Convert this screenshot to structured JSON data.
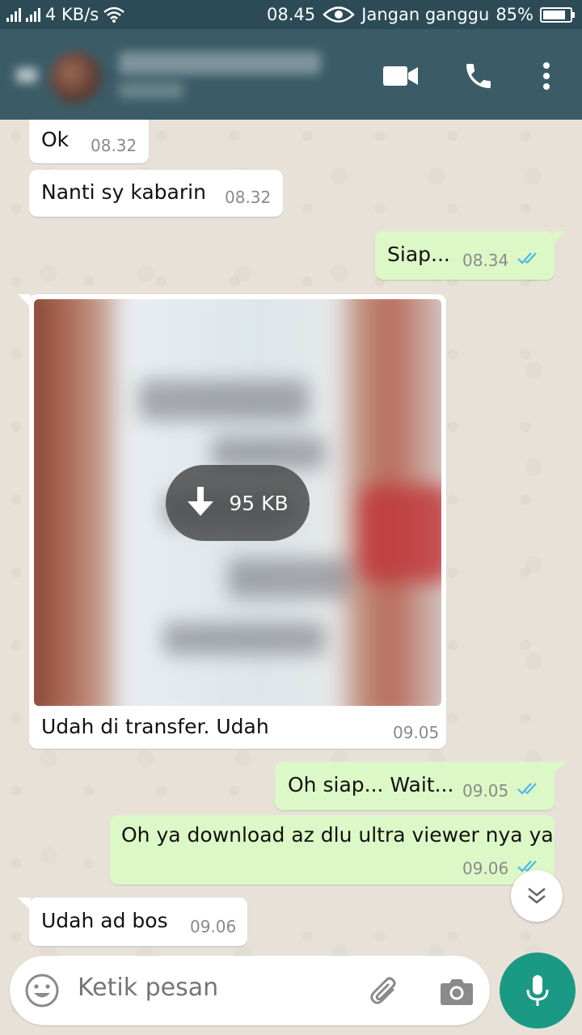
{
  "status_bar": {
    "network_speed": "4 KB/s",
    "time": "08.45",
    "dnd_label": "Jangan ganggu",
    "battery": "85%",
    "battery_level": 0.85
  },
  "header": {
    "contact_name": "",
    "contact_status": "",
    "icons": [
      "video-call-icon",
      "phone-icon",
      "more-vert-icon"
    ]
  },
  "messages": [
    {
      "dir": "in",
      "text": "Ok",
      "time": "08.32"
    },
    {
      "dir": "in",
      "text": "Nanti sy kabarin",
      "time": "08.32"
    },
    {
      "dir": "out",
      "text": "Siap...",
      "time": "08.34",
      "read": true
    },
    {
      "dir": "in",
      "type": "image",
      "download_size": "95 KB",
      "caption": "Udah di transfer. Udah",
      "time": "09.05"
    },
    {
      "dir": "out",
      "text": "Oh siap... Wait...",
      "time": "09.05",
      "read": true
    },
    {
      "dir": "out",
      "text": "Oh ya download az dlu ultra viewer nya ya",
      "time": "09.06",
      "read": true
    },
    {
      "dir": "in",
      "text": "Udah ad bos",
      "time": "09.06"
    }
  ],
  "composer": {
    "placeholder": "Ketik pesan"
  },
  "colors": {
    "header": "#3b5c67",
    "status_bar": "#2c4b56",
    "outgoing_bubble": "#dcf8c6",
    "incoming_bubble": "#ffffff",
    "read_ticks": "#4fb6ec",
    "mic_button": "#1a9a84",
    "chat_background": "#e8e1d8"
  }
}
